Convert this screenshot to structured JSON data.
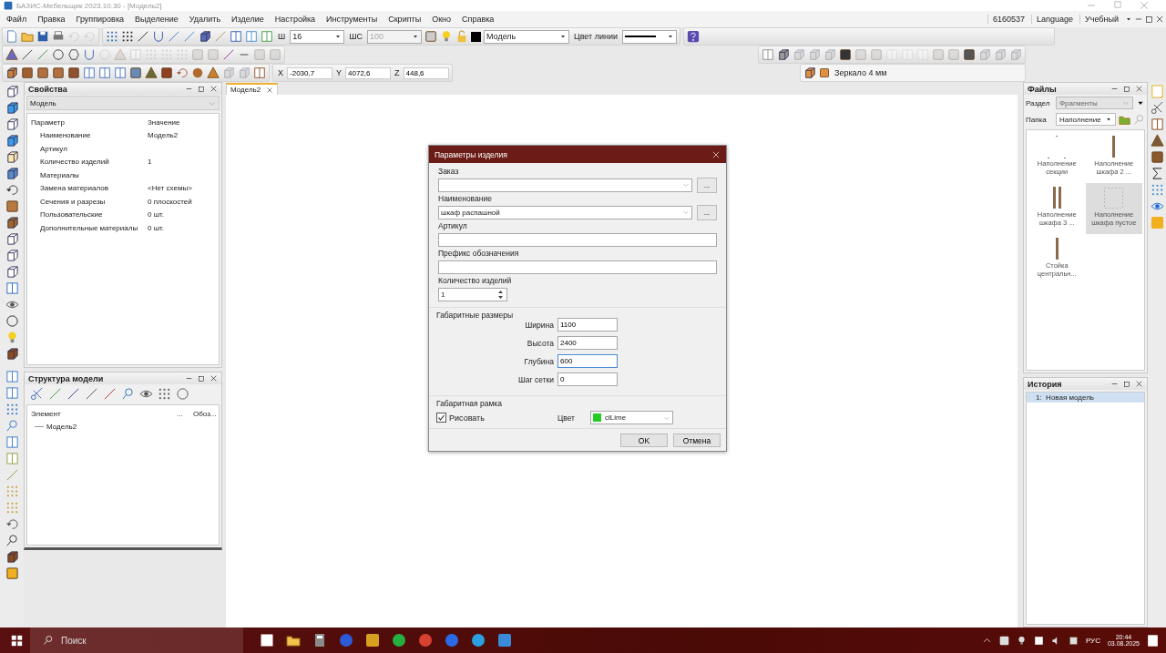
{
  "window": {
    "title": "БАЗИС-Мебельщик 2023.10.30 - [Модель2]"
  },
  "menu": [
    "Файл",
    "Правка",
    "Группировка",
    "Выделение",
    "Удалить",
    "Изделие",
    "Настройка",
    "Инструменты",
    "Скрипты",
    "Окно",
    "Справка"
  ],
  "menu_right": {
    "license": "6160537",
    "language": "Language",
    "mode": "Учебный"
  },
  "toolbar": {
    "width_label": "Ш",
    "width_value": "16",
    "style_label": "ШС",
    "style_value": "100",
    "style_disabled": true,
    "layer": "Модель",
    "line_color_label": "Цвет линии"
  },
  "coords": [
    {
      "axis": "X",
      "value": "-2030,7"
    },
    {
      "axis": "Y",
      "value": "4072,6"
    },
    {
      "axis": "Z",
      "value": "448,6"
    }
  ],
  "material": "Зеркало 4 мм",
  "properties": {
    "title": "Свойства",
    "object": "Модель",
    "columns": [
      "Параметр",
      "Значение"
    ],
    "rows": [
      {
        "name": "Наименование",
        "value": "Модель2"
      },
      {
        "name": "Артикул"
      },
      {
        "name": "Количество изделий",
        "value": "1"
      },
      {
        "name": "Материалы"
      },
      {
        "name": "Замена материалов",
        "value": "<Нет схемы>"
      },
      {
        "name": "Сечения и разрезы",
        "value": "0 плоскостей"
      },
      {
        "name": "Пользовательские",
        "value": "0 шт."
      },
      {
        "name": "Дополнительные материалы",
        "value": "0 шт."
      }
    ]
  },
  "structure": {
    "title": "Структура модели",
    "columns": [
      "Элемент",
      "...",
      "Обоз..."
    ],
    "tree": [
      {
        "label": "Модель2"
      }
    ]
  },
  "document_tabs": [
    {
      "label": "Модель2",
      "selected": true
    }
  ],
  "dialog": {
    "title": "Параметры изделия",
    "fields": [
      {
        "kind": "combo",
        "label": "Заказ",
        "more": "..."
      },
      {
        "kind": "combo",
        "label": "Наименование",
        "value": "шкаф распашной",
        "more": "..."
      },
      {
        "kind": "text",
        "label": "Артикул"
      },
      {
        "kind": "text",
        "label": "Префикс обозначения"
      },
      {
        "kind": "spin",
        "label": "Количество изделий",
        "value": "1"
      }
    ],
    "dimensions": {
      "title": "Габаритные размеры",
      "items": [
        {
          "label": "Ширина",
          "value": "1100",
          "focused": false
        },
        {
          "label": "Высота",
          "value": "2400",
          "focused": false
        },
        {
          "label": "Глубина",
          "value": "600",
          "focused": true
        },
        {
          "label": "Шаг сетки",
          "value": "0",
          "focused": false
        }
      ]
    },
    "frame": {
      "title": "Габаритная рамка",
      "draw_label": "Рисовать",
      "checked": true,
      "color_label": "Цвет",
      "color_name": "clLime",
      "color": "#22cc22"
    },
    "buttons": [
      "OK",
      "Отмена"
    ]
  },
  "files": {
    "title": "Файлы",
    "section_label": "Раздел",
    "section": "Фрагменты",
    "folder_label": "Папка",
    "folder": "Наполнение",
    "items": [
      {
        "label": "Наполнение секции",
        "kind": "dots",
        "selected": false
      },
      {
        "label": "Наполнение шкафа 2 ...",
        "kind": "post",
        "selected": false
      },
      {
        "label": "Наполнение шкафа 3 ...",
        "kind": "posts",
        "selected": false
      },
      {
        "label": "Наполнение шкафа пустое",
        "kind": "frame",
        "selected": true
      },
      {
        "label": "Стойка центральн...",
        "kind": "post",
        "selected": false
      }
    ]
  },
  "history": {
    "title": "История",
    "items": [
      {
        "label": "1:  Новая модель",
        "selected": true
      }
    ]
  },
  "taskbar": {
    "search_placeholder": "Поиск",
    "language": "РУС",
    "time": "20:44",
    "date": "03.08.2025"
  }
}
